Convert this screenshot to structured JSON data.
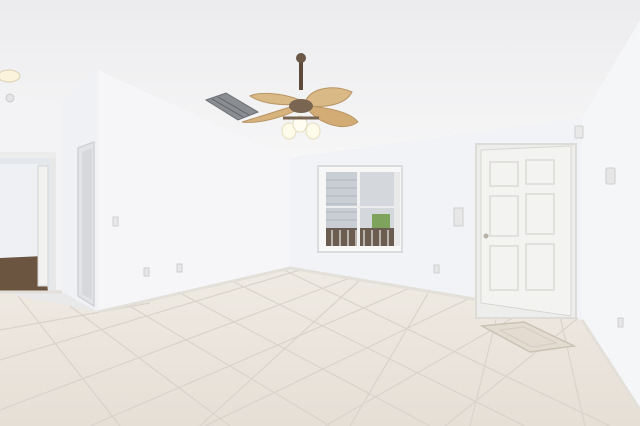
{
  "scene": {
    "description_free": true,
    "colors": {
      "ceiling": "#f1f1f2",
      "wall_left": "#f6f6f8",
      "wall_back": "#f2f3f6",
      "wall_right": "#f4f5f7",
      "floor": "#eae5df",
      "grout": "#d8d2ca",
      "door": "#f3f3f1",
      "fan_blade": "#d9b985",
      "baseboard": "#e6e3de",
      "hall_floor": "#6b5440"
    }
  }
}
